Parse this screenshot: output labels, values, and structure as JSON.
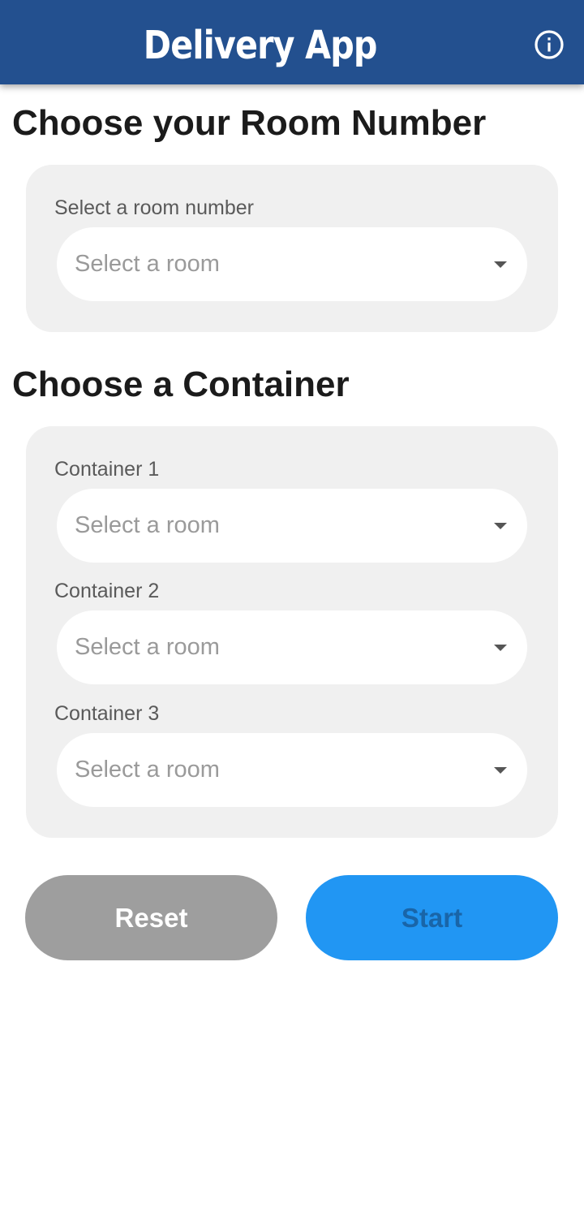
{
  "app": {
    "title": "Delivery App",
    "info_icon": "info-icon"
  },
  "room_section": {
    "title": "Choose your Room Number",
    "field_label": "Select a room number",
    "placeholder": "Select a room"
  },
  "container_section": {
    "title": "Choose a Container",
    "containers": [
      {
        "label": "Container 1",
        "placeholder": "Select a room"
      },
      {
        "label": "Container 2",
        "placeholder": "Select a room"
      },
      {
        "label": "Container 3",
        "placeholder": "Select a room"
      }
    ]
  },
  "actions": {
    "reset_label": "Reset",
    "start_label": "Start"
  },
  "colors": {
    "app_bar": "#23508f",
    "card_background": "#f0f0f0",
    "reset_button": "#9e9e9e",
    "start_button": "#2196f3",
    "start_text": "#1965a8"
  }
}
